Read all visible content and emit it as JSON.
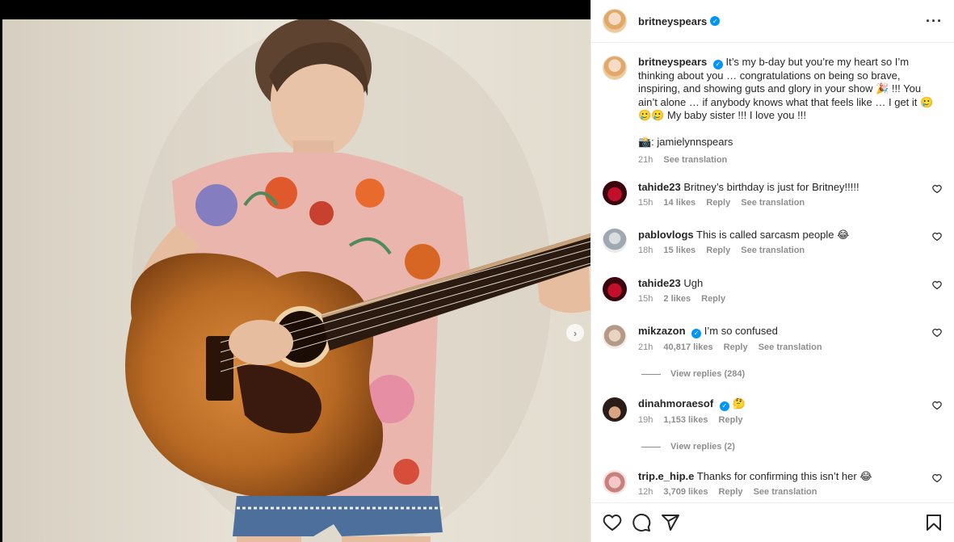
{
  "post": {
    "username": "britneyspears",
    "more_icon": "more-horizontal-icon",
    "next_icon": "chevron-right-icon"
  },
  "caption": {
    "username": "britneyspears",
    "text": "It’s my b-day but you’re my heart so I’m thinking about you … congratulations on being so brave, inspiring, and showing guts and glory in your show 🎉 !!! You ain’t alone … if anybody knows what that feels like … I get it 🥲🥲🥲 My baby sister !!! I love you !!!",
    "credit": "📸: jamielynnspears",
    "time": "21h",
    "see_translation": "See translation"
  },
  "comments": [
    {
      "username": "tahide23",
      "verified": false,
      "text": "Britney’s birthday is just for Britney!!!!!",
      "time": "15h",
      "likes": "14 likes",
      "reply": "Reply",
      "see_translation": "See translation"
    },
    {
      "username": "pablovlogs",
      "verified": false,
      "text": "This is called sarcasm people 😂",
      "time": "18h",
      "likes": "15 likes",
      "reply": "Reply",
      "see_translation": "See translation"
    },
    {
      "username": "tahide23",
      "verified": false,
      "text": "Ugh",
      "time": "15h",
      "likes": "2 likes",
      "reply": "Reply",
      "see_translation": ""
    },
    {
      "username": "mikzazon",
      "verified": true,
      "text": "I’m so confused",
      "time": "21h",
      "likes": "40,817 likes",
      "reply": "Reply",
      "see_translation": "See translation",
      "view_replies": "View replies (284)"
    },
    {
      "username": "dinahmoraesof",
      "verified": true,
      "text": "🤔",
      "time": "19h",
      "likes": "1,153 likes",
      "reply": "Reply",
      "see_translation": "",
      "view_replies": "View replies (2)"
    },
    {
      "username": "trip.e_hip.e",
      "verified": false,
      "text": "Thanks for confirming this isn’t her 😂",
      "time": "12h",
      "likes": "3,709 likes",
      "reply": "Reply",
      "see_translation": "See translation"
    }
  ],
  "actions": {
    "like_icon": "heart-icon",
    "comment_icon": "comment-icon",
    "share_icon": "send-icon",
    "save_icon": "bookmark-icon"
  },
  "colors": {
    "verified": "#0095f6",
    "secondary_text": "#8e8e8e",
    "primary_text": "#262626",
    "border": "#efefef"
  }
}
